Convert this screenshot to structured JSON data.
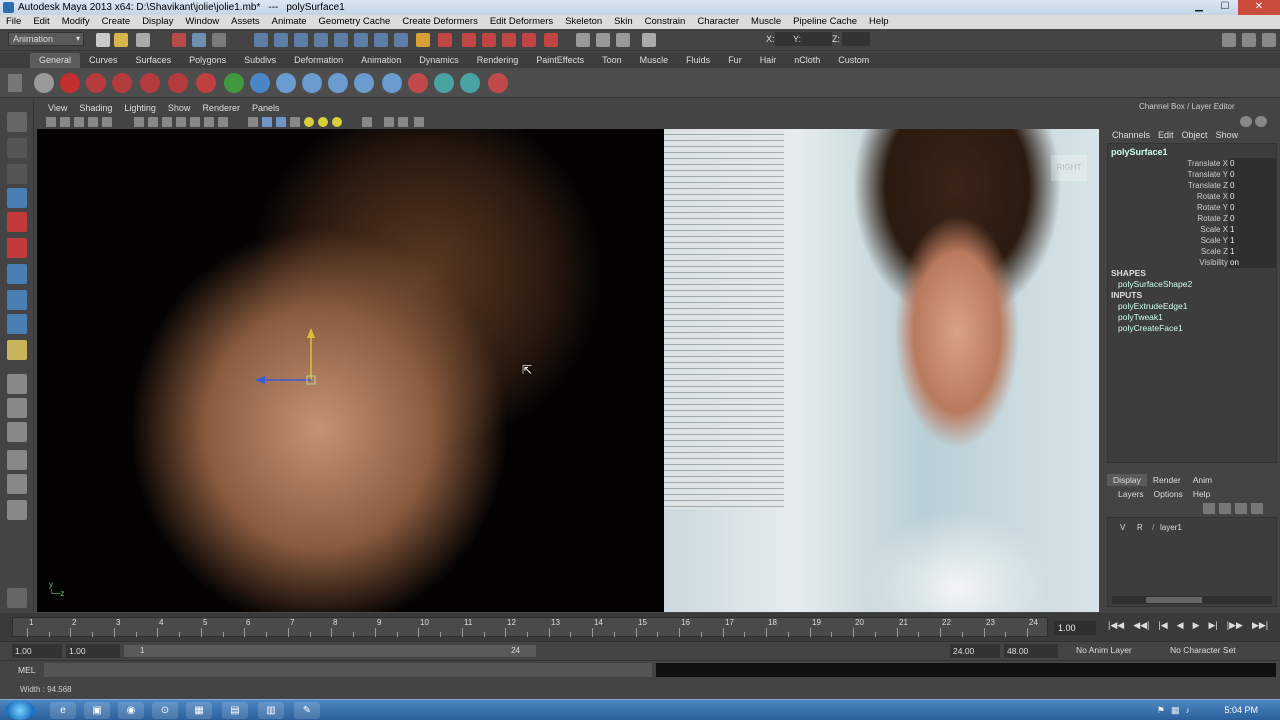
{
  "window": {
    "title": "Autodesk Maya 2013 x64: D:\\Shavikant\\jolie\\jolie1.mb*",
    "separator": "---",
    "object": "polySurface1",
    "min": "▁",
    "max": "☐",
    "close": "✕"
  },
  "menubar": [
    "File",
    "Edit",
    "Modify",
    "Create",
    "Display",
    "Window",
    "Assets",
    "Animate",
    "Geometry Cache",
    "Create Deformers",
    "Edit Deformers",
    "Skeleton",
    "Skin",
    "Constrain",
    "Character",
    "Muscle",
    "Pipeline Cache",
    "Help"
  ],
  "statusline": {
    "mode": "Animation",
    "x_label": "X:",
    "y_label": "Y:",
    "z_label": "Z:"
  },
  "shelf_tabs": [
    "General",
    "Curves",
    "Surfaces",
    "Polygons",
    "Subdivs",
    "Deformation",
    "Animation",
    "Dynamics",
    "Rendering",
    "PaintEffects",
    "Toon",
    "Muscle",
    "Fluids",
    "Fur",
    "Hair",
    "nCloth",
    "Custom"
  ],
  "shelf_active": "General",
  "panel_menu": [
    "View",
    "Shading",
    "Lighting",
    "Show",
    "Renderer",
    "Panels"
  ],
  "viewport": {
    "camera_label": "RIGHT"
  },
  "channel_box": {
    "title": "Channel Box / Layer Editor",
    "menu": [
      "Channels",
      "Edit",
      "Object",
      "Show"
    ],
    "object": "polySurface1",
    "channels": [
      {
        "label": "Translate X",
        "value": "0"
      },
      {
        "label": "Translate Y",
        "value": "0"
      },
      {
        "label": "Translate Z",
        "value": "0"
      },
      {
        "label": "Rotate X",
        "value": "0"
      },
      {
        "label": "Rotate Y",
        "value": "0"
      },
      {
        "label": "Rotate Z",
        "value": "0"
      },
      {
        "label": "Scale X",
        "value": "1"
      },
      {
        "label": "Scale Y",
        "value": "1"
      },
      {
        "label": "Scale Z",
        "value": "1"
      },
      {
        "label": "Visibility",
        "value": "on"
      }
    ],
    "shapes_header": "SHAPES",
    "shape": "polySurfaceShape2",
    "inputs_header": "INPUTS",
    "inputs": [
      "polyExtrudeEdge1",
      "polyTweak1",
      "polyCreateFace1"
    ]
  },
  "layer_editor": {
    "tabs": [
      "Display",
      "Render",
      "Anim"
    ],
    "active_tab": "Display",
    "menu": [
      "Layers",
      "Options",
      "Help"
    ],
    "layers": [
      {
        "v": "V",
        "r": "R",
        "name": "layer1"
      }
    ]
  },
  "timeline": {
    "ticks": [
      "1",
      "2",
      "3",
      "4",
      "5",
      "6",
      "7",
      "8",
      "9",
      "10",
      "11",
      "12",
      "13",
      "14",
      "15",
      "16",
      "17",
      "18",
      "19",
      "20",
      "21",
      "22",
      "23",
      "24"
    ],
    "current_frame": "1.00",
    "buttons": [
      "|◀◀",
      "◀◀|",
      "|◀",
      "◀",
      "▶",
      "▶|",
      "|▶▶",
      "▶▶|"
    ]
  },
  "range": {
    "start": "1.00",
    "start2": "1.00",
    "bar_start": "1",
    "bar_end": "24",
    "end": "24.00",
    "end2": "48.00",
    "anim_layer": "No Anim Layer",
    "char_set": "No Character Set"
  },
  "cmdline": {
    "label": "MEL"
  },
  "helpline": {
    "text": "Width : 94.568"
  },
  "taskbar": {
    "time": "5:04 PM",
    "apps": [
      "e",
      "▣",
      "◉",
      "⊙",
      "▦",
      "▤",
      "▥",
      "✎"
    ]
  }
}
